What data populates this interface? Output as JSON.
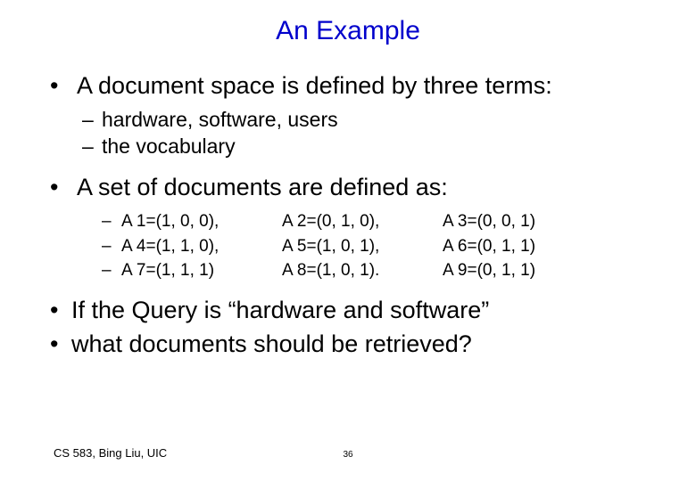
{
  "title": "An Example",
  "bullets": {
    "b1": "A document space is defined by three terms:",
    "b1_sub": {
      "s1": "hardware,  software, users",
      "s2": "the vocabulary"
    },
    "b2": "A set of documents are defined as:",
    "b2_rows": [
      {
        "c1": "A 1=(1, 0, 0),",
        "c2": "A 2=(0, 1, 0),",
        "c3": "A 3=(0, 0, 1)"
      },
      {
        "c1": "A 4=(1, 1, 0),",
        "c2": "A 5=(1, 0, 1),",
        "c3": "A 6=(0, 1, 1)"
      },
      {
        "c1": "A 7=(1, 1, 1)",
        "c2": "A 8=(1, 0, 1).",
        "c3": "A 9=(0, 1, 1)"
      }
    ],
    "b3": "If the Query is “hardware and software”",
    "b4": "what documents should be retrieved?"
  },
  "footer": {
    "left": "CS 583, Bing Liu, UIC",
    "page": "36"
  }
}
